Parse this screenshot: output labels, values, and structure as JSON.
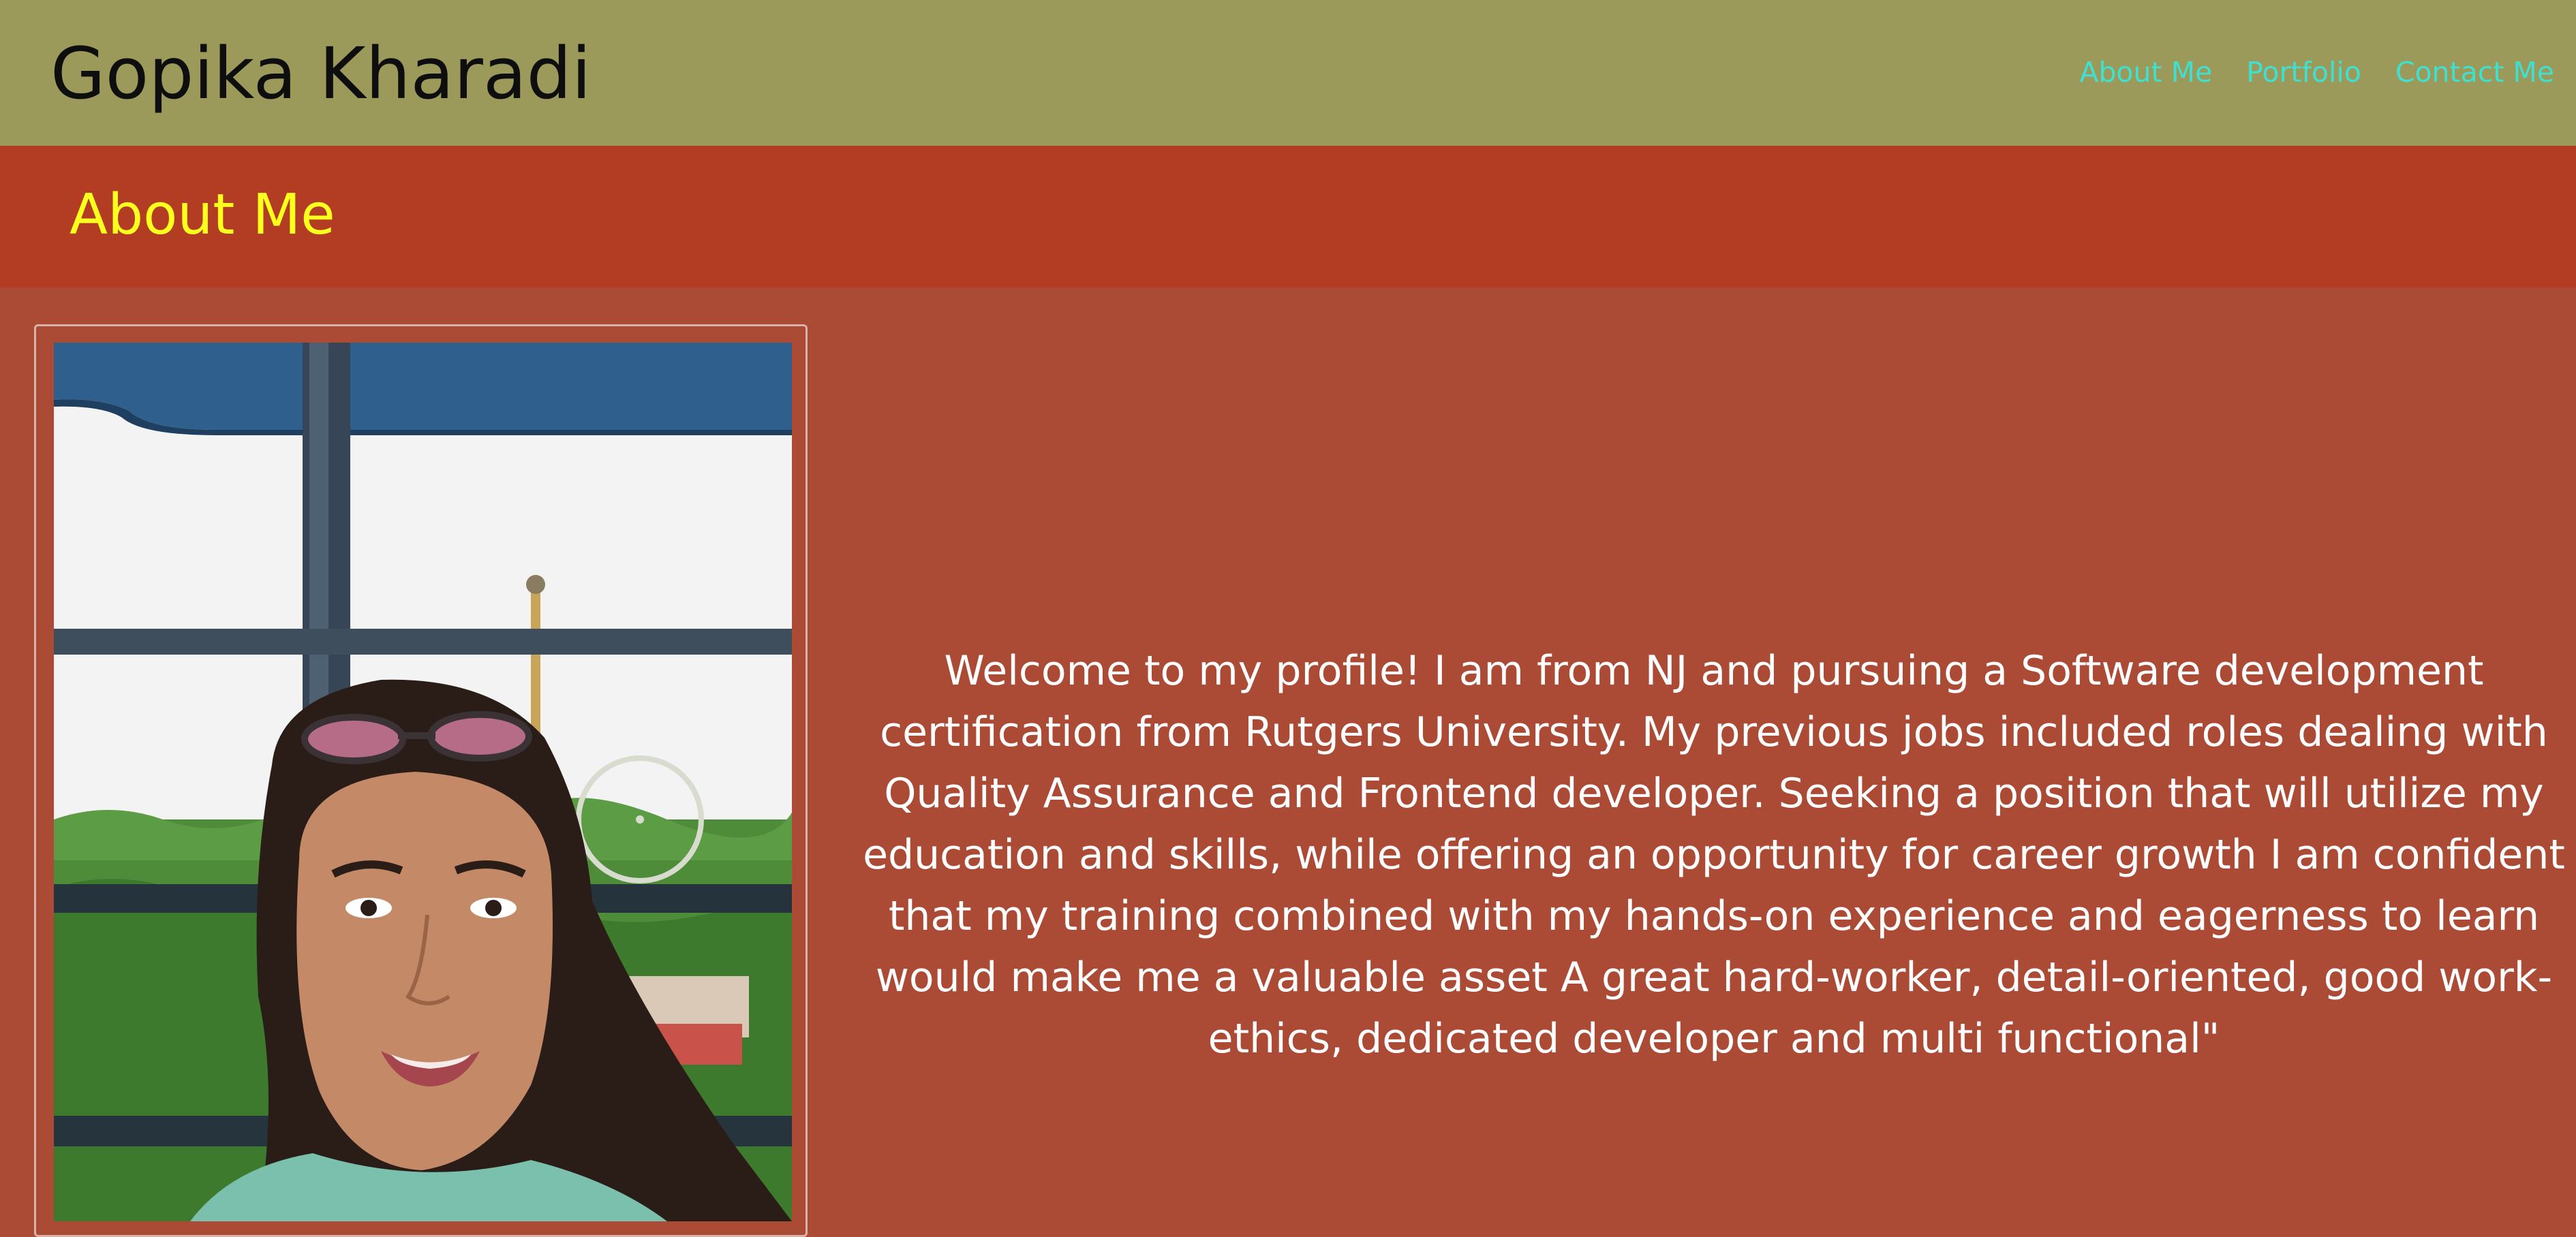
{
  "header": {
    "site_title": "Gopika Kharadi",
    "nav": [
      {
        "label": "About Me"
      },
      {
        "label": "Portfolio"
      },
      {
        "label": "Contact Me"
      }
    ]
  },
  "about": {
    "heading": "About Me",
    "photo_alt": "Portrait photo",
    "bio": "Welcome to my profile! I am from NJ and pursuing a Software development certification from Rutgers University. My previous jobs included roles dealing with Quality Assurance and Frontend developer. Seeking a position that will utilize my education and skills, while offering an opportunity for career growth I am confident that my training combined with my hands-on experience and eagerness to learn would make me a valuable asset A great hard-worker, detail-oriented, good work-ethics, dedicated developer and multi functional\""
  },
  "colors": {
    "header_bg": "#9b9a5b",
    "nav_link": "#40e0d0",
    "section_band": "#b33d22",
    "heading_text": "#ffff1f",
    "page_bg": "#ab4a35"
  }
}
